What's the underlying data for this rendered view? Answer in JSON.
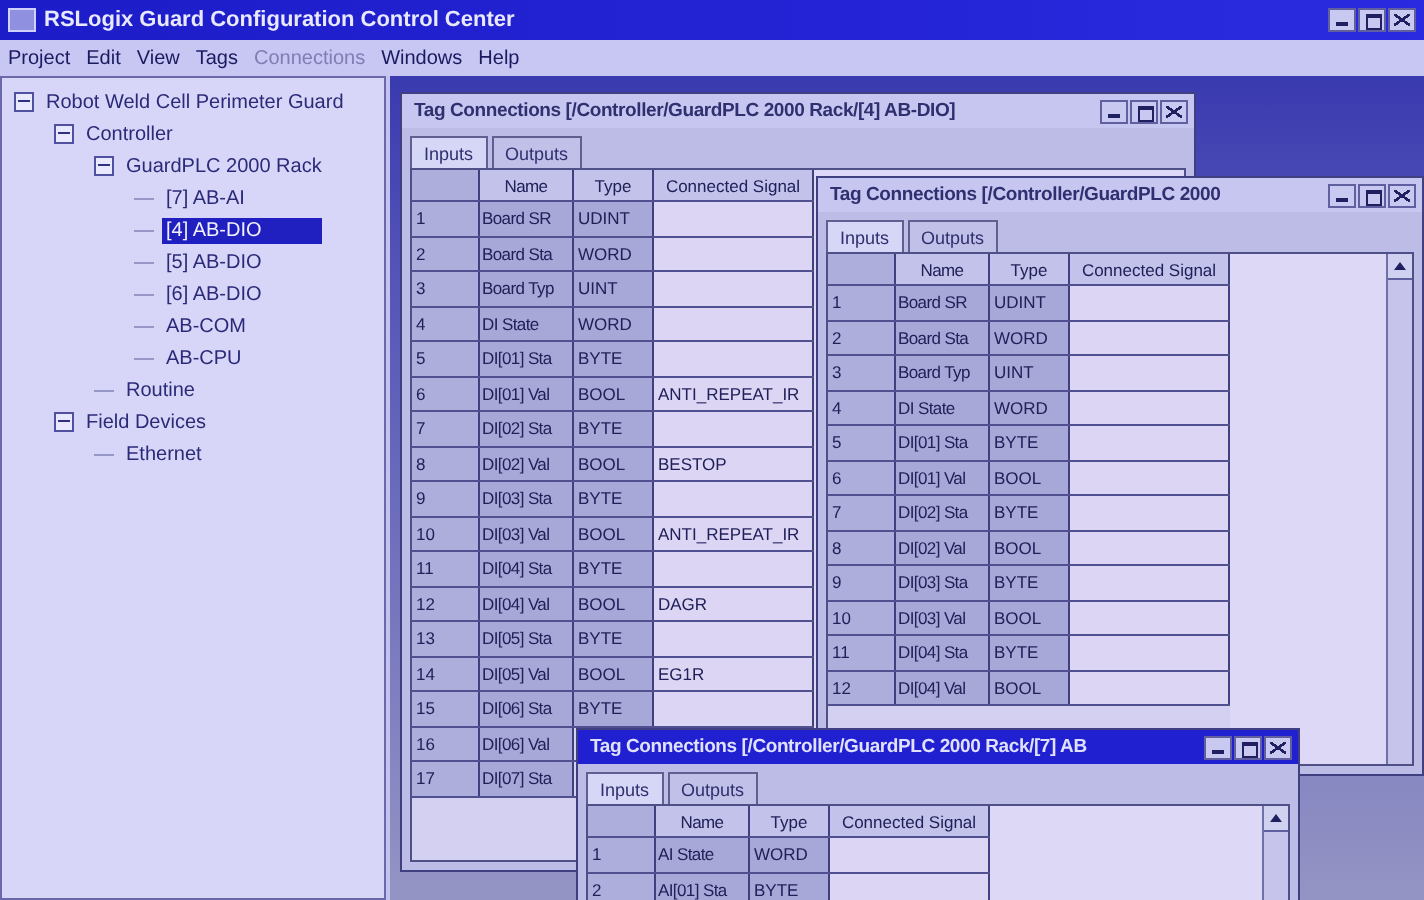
{
  "app": {
    "title": "RSLogix Guard Configuration Control Center",
    "menu": [
      {
        "label": "Project",
        "disabled": false
      },
      {
        "label": "Edit",
        "disabled": false
      },
      {
        "label": "View",
        "disabled": false
      },
      {
        "label": "Tags",
        "disabled": false
      },
      {
        "label": "Connections",
        "disabled": true
      },
      {
        "label": "Windows",
        "disabled": false
      },
      {
        "label": "Help",
        "disabled": false
      }
    ]
  },
  "tree": [
    {
      "label": "Robot Weld Cell Perimeter Guard",
      "expanded": true,
      "selected": false,
      "children": [
        {
          "label": "Controller",
          "expanded": true,
          "selected": false,
          "children": [
            {
              "label": "GuardPLC 2000 Rack",
              "expanded": true,
              "selected": false,
              "children": [
                {
                  "label": "[7] AB-AI",
                  "selected": false
                },
                {
                  "label": "[4] AB-DIO",
                  "selected": true
                },
                {
                  "label": "[5] AB-DIO",
                  "selected": false
                },
                {
                  "label": "[6] AB-DIO",
                  "selected": false
                },
                {
                  "label": "AB-COM",
                  "selected": false
                },
                {
                  "label": "AB-CPU",
                  "selected": false
                }
              ]
            },
            {
              "label": "Routine",
              "selected": false
            }
          ]
        },
        {
          "label": "Field Devices",
          "expanded": true,
          "selected": false,
          "children": [
            {
              "label": "Ethernet",
              "selected": false
            }
          ]
        }
      ]
    }
  ],
  "windows": [
    {
      "title": "Tag Connections [/Controller/GuardPLC 2000 Rack/[4] AB-DIO]",
      "active": false,
      "tabs": [
        {
          "label": "Inputs",
          "selected": true
        },
        {
          "label": "Outputs",
          "selected": false
        }
      ],
      "columns": [
        "Name",
        "Type",
        "Connected Signal"
      ],
      "rows": [
        {
          "num": "1",
          "name": "Board SR",
          "type": "UDINT"
        },
        {
          "num": "2",
          "name": "Board Sta",
          "type": "WORD"
        },
        {
          "num": "3",
          "name": "Board Typ",
          "type": "UINT"
        },
        {
          "num": "4",
          "name": "DI State",
          "type": "WORD"
        },
        {
          "num": "5",
          "name": "DI[01] Sta",
          "type": "BYTE"
        },
        {
          "num": "6",
          "name": "DI[01] Val",
          "type": "BOOL",
          "signal": "ANTI_REPEAT_IR"
        },
        {
          "num": "7",
          "name": "DI[02] Sta",
          "type": "BYTE"
        },
        {
          "num": "8",
          "name": "DI[02] Val",
          "type": "BOOL",
          "signal": "BESTOP"
        },
        {
          "num": "9",
          "name": "DI[03] Sta",
          "type": "BYTE"
        },
        {
          "num": "10",
          "name": "DI[03] Val",
          "type": "BOOL",
          "signal": "ANTI_REPEAT_IR"
        },
        {
          "num": "11",
          "name": "DI[04] Sta",
          "type": "BYTE"
        },
        {
          "num": "12",
          "name": "DI[04] Val",
          "type": "BOOL",
          "signal": "DAGR"
        },
        {
          "num": "13",
          "name": "DI[05] Sta",
          "type": "BYTE"
        },
        {
          "num": "14",
          "name": "DI[05] Val",
          "type": "BOOL",
          "signal": "EG1R"
        },
        {
          "num": "15",
          "name": "DI[06] Sta",
          "type": "BYTE"
        },
        {
          "num": "16",
          "name": "DI[06] Val"
        },
        {
          "num": "17",
          "name": "DI[07] Sta"
        }
      ]
    },
    {
      "title": "Tag Connections [/Controller/GuardPLC 2000",
      "active": false,
      "tabs": [
        {
          "label": "Inputs",
          "selected": true
        },
        {
          "label": "Outputs",
          "selected": false
        }
      ],
      "columns": [
        "Name",
        "Type",
        "Connected Signal"
      ],
      "rows": [
        {
          "num": "1",
          "name": "Board SR",
          "type": "UDINT"
        },
        {
          "num": "2",
          "name": "Board Sta",
          "type": "WORD"
        },
        {
          "num": "3",
          "name": "Board Typ",
          "type": "UINT"
        },
        {
          "num": "4",
          "name": "DI State",
          "type": "WORD"
        },
        {
          "num": "5",
          "name": "DI[01] Sta",
          "type": "BYTE"
        },
        {
          "num": "6",
          "name": "DI[01] Val",
          "type": "BOOL"
        },
        {
          "num": "7",
          "name": "DI[02] Sta",
          "type": "BYTE"
        },
        {
          "num": "8",
          "name": "DI[02] Val",
          "type": "BOOL"
        },
        {
          "num": "9",
          "name": "DI[03] Sta",
          "type": "BYTE"
        },
        {
          "num": "10",
          "name": "DI[03] Val",
          "type": "BOOL"
        },
        {
          "num": "11",
          "name": "DI[04] Sta",
          "type": "BYTE"
        },
        {
          "num": "12",
          "name": "DI[04] Val",
          "type": "BOOL"
        }
      ]
    },
    {
      "title": "Tag Connections [/Controller/GuardPLC 2000 Rack/[7] AB",
      "active": true,
      "tabs": [
        {
          "label": "Inputs",
          "selected": true
        },
        {
          "label": "Outputs",
          "selected": false
        }
      ],
      "columns": [
        "Name",
        "Type",
        "Connected Signal"
      ],
      "rows": [
        {
          "num": "1",
          "name": "AI State",
          "type": "WORD"
        },
        {
          "num": "2",
          "name": "AI[01] Sta",
          "type": "BYTE"
        }
      ]
    }
  ]
}
